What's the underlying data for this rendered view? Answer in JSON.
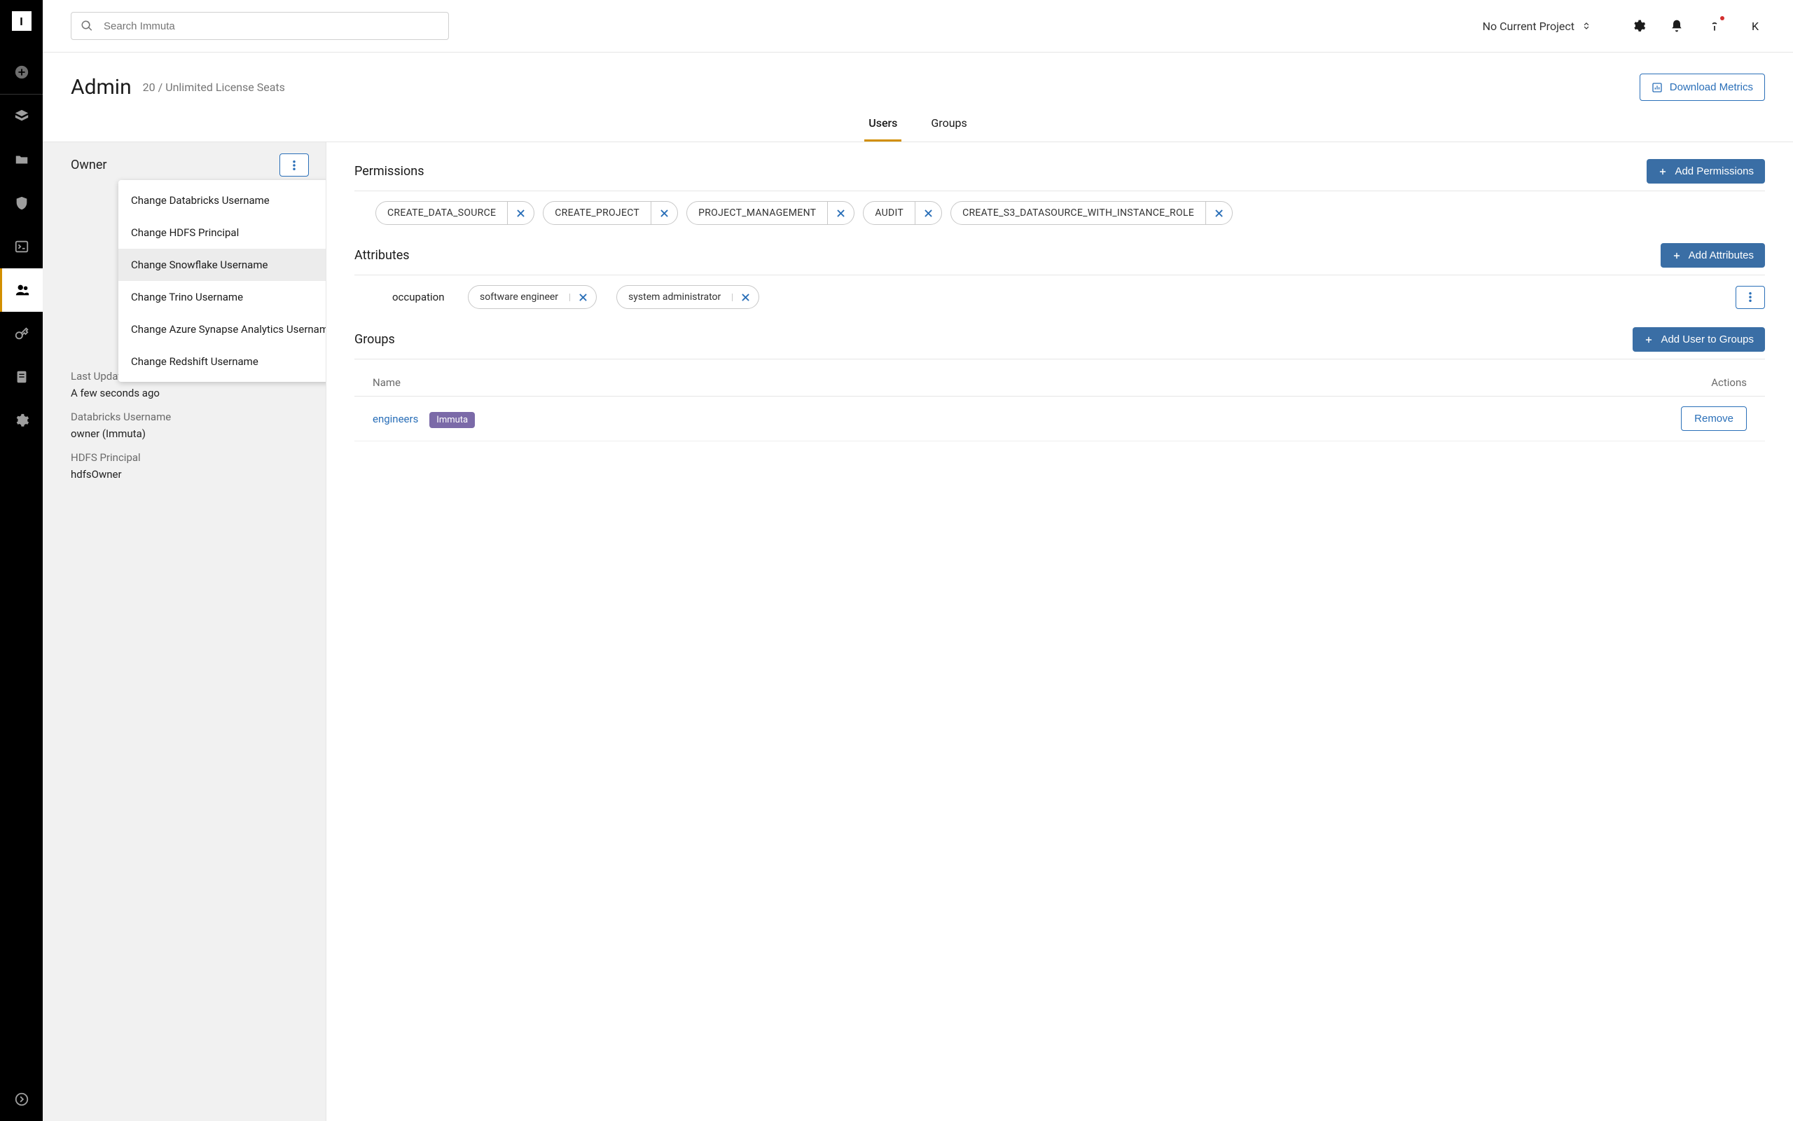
{
  "search": {
    "placeholder": "Search Immuta"
  },
  "project_selector": {
    "label": "No Current Project"
  },
  "header": {
    "title": "Admin",
    "subtitle": "20 / Unlimited License Seats",
    "download_btn": "Download Metrics"
  },
  "tabs": {
    "users": "Users",
    "groups": "Groups"
  },
  "owner_panel": {
    "title": "Owner",
    "menu": [
      "Change Databricks Username",
      "Change HDFS Principal",
      "Change Snowflake Username",
      "Change Trino Username",
      "Change Azure Synapse Analytics Username",
      "Change Redshift Username"
    ],
    "info": {
      "last_updated_label": "Last Updated",
      "last_updated_value": "A few seconds ago",
      "databricks_label": "Databricks Username",
      "databricks_value": "owner (Immuta)",
      "hdfs_label": "HDFS Principal",
      "hdfs_value": "hdfsOwner"
    }
  },
  "permissions": {
    "title": "Permissions",
    "add_btn": "Add Permissions",
    "chips": [
      "CREATE_DATA_SOURCE",
      "CREATE_PROJECT",
      "PROJECT_MANAGEMENT",
      "AUDIT",
      "CREATE_S3_DATASOURCE_WITH_INSTANCE_ROLE"
    ]
  },
  "attributes": {
    "title": "Attributes",
    "add_btn": "Add Attributes",
    "key": "occupation",
    "chips": [
      "software engineer",
      "system administrator"
    ]
  },
  "groups_section": {
    "title": "Groups",
    "add_btn": "Add User to Groups",
    "col_name": "Name",
    "col_actions": "Actions",
    "row": {
      "name": "engineers",
      "badge": "Immuta",
      "remove": "Remove"
    }
  },
  "avatar": "K"
}
